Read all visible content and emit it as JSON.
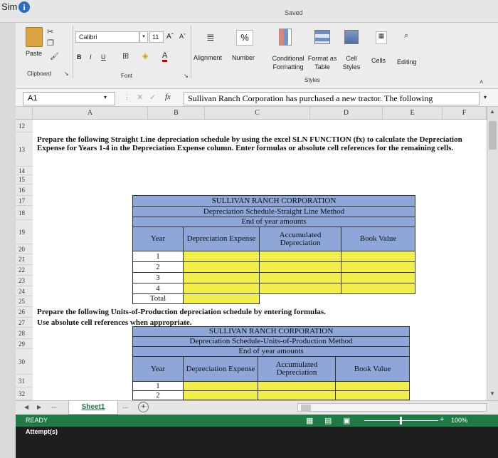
{
  "app": {
    "title": "Sim",
    "status": "Saved"
  },
  "ribbon": {
    "paste": "Paste",
    "clipboard": "Clipboard",
    "font_name": "Calibri",
    "font_size": "11",
    "bold": "B",
    "italic": "I",
    "underline": "U",
    "font_group": "Font",
    "alignment": "Alignment",
    "number": "Number",
    "number_symbol": "%",
    "conditional_formatting": "Conditional Formatting",
    "format_as_table": "Format as Table",
    "cell_styles": "Cell Styles",
    "styles_group": "Styles",
    "cells": "Cells",
    "editing": "Editing"
  },
  "formula_bar": {
    "name_box": "A1",
    "fx": "fx",
    "content": "Sullivan Ranch Corporation has purchased a new tractor.  The following"
  },
  "columns": [
    "A",
    "B",
    "C",
    "D",
    "E",
    "F"
  ],
  "rows": [
    "12",
    "13",
    "14",
    "15",
    "16",
    "17",
    "18",
    "19",
    "20",
    "21",
    "22",
    "23",
    "24",
    "25",
    "26",
    "27",
    "28",
    "29",
    "30",
    "31",
    "32"
  ],
  "instructions": {
    "sln": "Prepare the following Straight Line depreciation schedule by using the excel SLN FUNCTION (fx) to calculate the Depreciation Expense for Years 1-4 in the Depreciation Expense column. Enter formulas or absolute cell references for the remaining cells.",
    "uop_1": "Prepare the following Units-of-Production depreciation schedule by entering formulas.",
    "uop_2": "Use absolute cell references when appropriate."
  },
  "table1": {
    "company": "SULLIVAN RANCH CORPORATION",
    "subtitle": "Depreciation Schedule-Straight Line Method",
    "period": "End of year amounts",
    "headers": [
      "Year",
      "Depreciation Expense",
      "Accumulated Depreciation",
      "Book Value"
    ],
    "years": [
      "1",
      "2",
      "3",
      "4"
    ],
    "total": "Total"
  },
  "table2": {
    "company": "SULLIVAN RANCH CORPORATION",
    "subtitle": "Depreciation Schedule-Units-of-Production Method",
    "period": "End of year amounts",
    "headers": [
      "Year",
      "Depreciation Expense",
      "Accumulated Depreciation",
      "Book Value"
    ],
    "years": [
      "1",
      "2"
    ]
  },
  "sheet_tabs": {
    "active": "Sheet1",
    "more": "..."
  },
  "status": {
    "ready": "READY",
    "zoom": "100%",
    "attempts": "Attempt(s)"
  }
}
